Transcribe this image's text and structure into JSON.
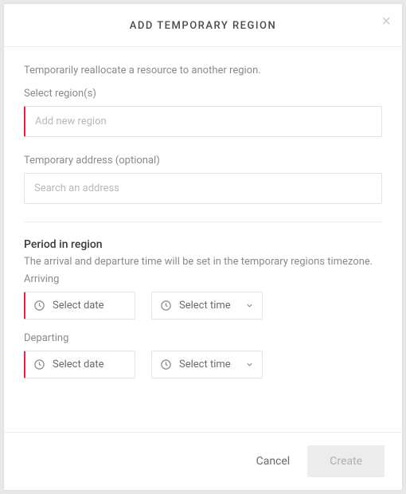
{
  "header": {
    "title": "ADD TEMPORARY REGION"
  },
  "body": {
    "description": "Temporarily reallocate a resource to another region.",
    "region": {
      "label": "Select region(s)",
      "placeholder": "Add new region"
    },
    "address": {
      "label": "Temporary address (optional)",
      "placeholder": "Search an address"
    },
    "period": {
      "title": "Period in region",
      "description": "The arrival and departure time will be set in the temporary regions timezone.",
      "arriving": {
        "label": "Arriving",
        "date_placeholder": "Select date",
        "time_placeholder": "Select time"
      },
      "departing": {
        "label": "Departing",
        "date_placeholder": "Select date",
        "time_placeholder": "Select time"
      }
    }
  },
  "footer": {
    "cancel": "Cancel",
    "create": "Create"
  }
}
